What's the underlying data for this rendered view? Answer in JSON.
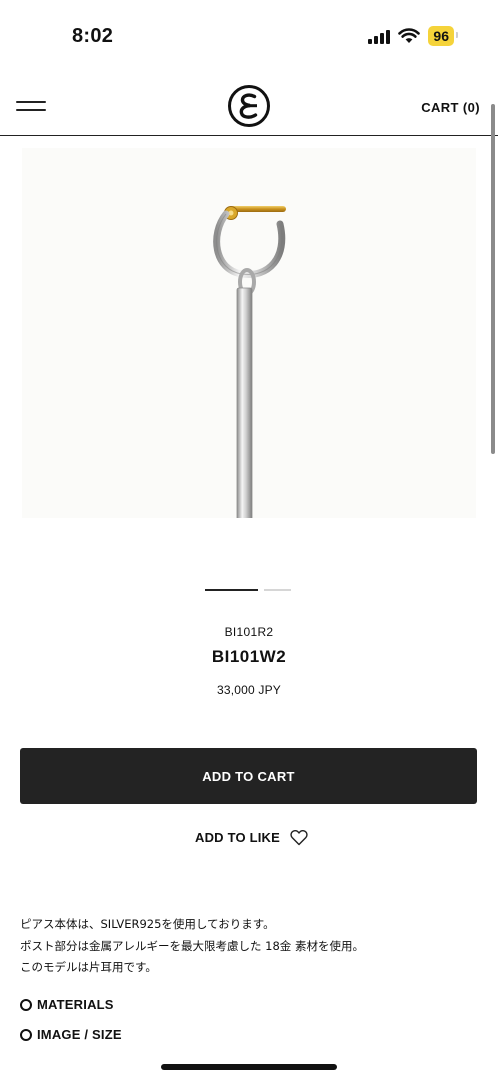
{
  "status_bar": {
    "time": "8:02",
    "battery": "96",
    "icons": [
      "signal-icon",
      "wifi-icon",
      "battery-icon"
    ]
  },
  "header": {
    "cart_label": "CART (0)",
    "icons": [
      "hamburger-menu-icon",
      "brand-logo"
    ]
  },
  "product": {
    "image_description_icon": "earring-photo",
    "sku": "BI101R2",
    "name": "BI101W2",
    "price": "33,000 JPY",
    "add_to_cart_label": "ADD TO CART",
    "add_to_like_label": "ADD TO LIKE",
    "carousel": {
      "total": 2,
      "active_index": 0
    }
  },
  "description": {
    "lines": [
      "ピアス本体は、SILVER925を使用しております。",
      "ポスト部分は金属アレルギーを最大限考慮した 18金 素材を使用。",
      "このモデルは片耳用です。"
    ]
  },
  "accordions": [
    {
      "label": "MATERIALS"
    },
    {
      "label": "IMAGE / SIZE"
    }
  ],
  "colors": {
    "button_bg": "#232323",
    "battery_bg": "#f5d33a",
    "gold": "#d9a72a",
    "silver": "#c9c9c9"
  }
}
